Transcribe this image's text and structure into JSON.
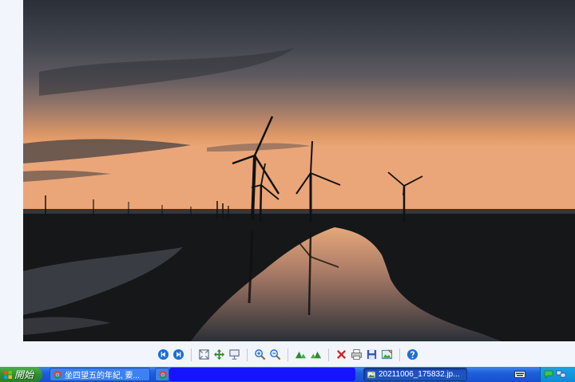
{
  "viewer": {
    "photo_alt": "",
    "toolbar": [
      {
        "name": "previous-image-button",
        "icon": "previous-icon",
        "color": "#1d6fd6"
      },
      {
        "name": "next-image-button",
        "icon": "next-icon",
        "color": "#1d6fd6"
      },
      {
        "sep": true
      },
      {
        "name": "best-fit-button",
        "icon": "best-fit-icon",
        "color": "#5a6c86"
      },
      {
        "name": "actual-size-button",
        "icon": "actual-size-icon",
        "color": "#2e8b2e"
      },
      {
        "name": "slideshow-button",
        "icon": "slideshow-icon",
        "color": "#5a6c86"
      },
      {
        "sep": true
      },
      {
        "name": "zoom-in-button",
        "icon": "zoom-in-icon",
        "color": "#1d6fd6"
      },
      {
        "name": "zoom-out-button",
        "icon": "zoom-out-icon",
        "color": "#1d6fd6"
      },
      {
        "sep": true
      },
      {
        "name": "rotate-clockwise-button",
        "icon": "rotate-clockwise-icon",
        "color": "#2e8b2e"
      },
      {
        "name": "rotate-counterclockwise-button",
        "icon": "rotate-counterclockwise-icon",
        "color": "#2e8b2e"
      },
      {
        "sep": true
      },
      {
        "name": "delete-button",
        "icon": "delete-icon",
        "color": "#d32020"
      },
      {
        "name": "print-button",
        "icon": "print-icon",
        "color": "#6b6b6b"
      },
      {
        "name": "save-button",
        "icon": "save-icon",
        "color": "#3355aa"
      },
      {
        "name": "edit-button",
        "icon": "edit-image-icon",
        "color": "#2e7d9b"
      },
      {
        "sep": true
      },
      {
        "name": "help-button",
        "icon": "help-icon",
        "color": "#1d6fd6"
      }
    ]
  },
  "taskbar": {
    "start_label": "開始",
    "tasks": [
      {
        "label": "坐四望五的年紀, 要...",
        "icon": "chrome-icon"
      },
      {
        "label": "",
        "icon": "chrome-icon"
      },
      {
        "label": "20211006_175832.jp...",
        "icon": "image-viewer-icon"
      }
    ],
    "tray_icons": [
      "keyboard-icon",
      "chat-icon",
      "network-icon"
    ]
  }
}
